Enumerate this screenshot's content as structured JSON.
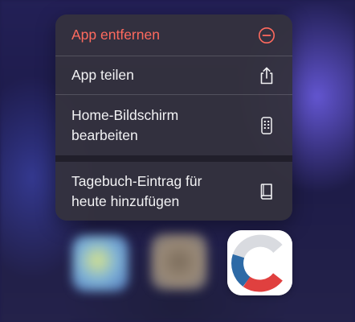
{
  "context_menu": {
    "items": [
      {
        "label": "App entfernen",
        "icon": "minus-circle-icon",
        "color": "#ff6a5e"
      },
      {
        "label": "App teilen",
        "icon": "share-icon"
      },
      {
        "label": "Home-Bildschirm\nbearbeiten",
        "icon": "phone-icon"
      },
      {
        "label": "Tagebuch-Eintrag für\nheute hinzufügen",
        "icon": "book-icon"
      }
    ]
  },
  "app": {
    "icon": "corona-warn-app-icon",
    "colors": {
      "red": "#e0403f",
      "blue": "#2d6aa6",
      "grey": "#d9dbe0"
    }
  }
}
